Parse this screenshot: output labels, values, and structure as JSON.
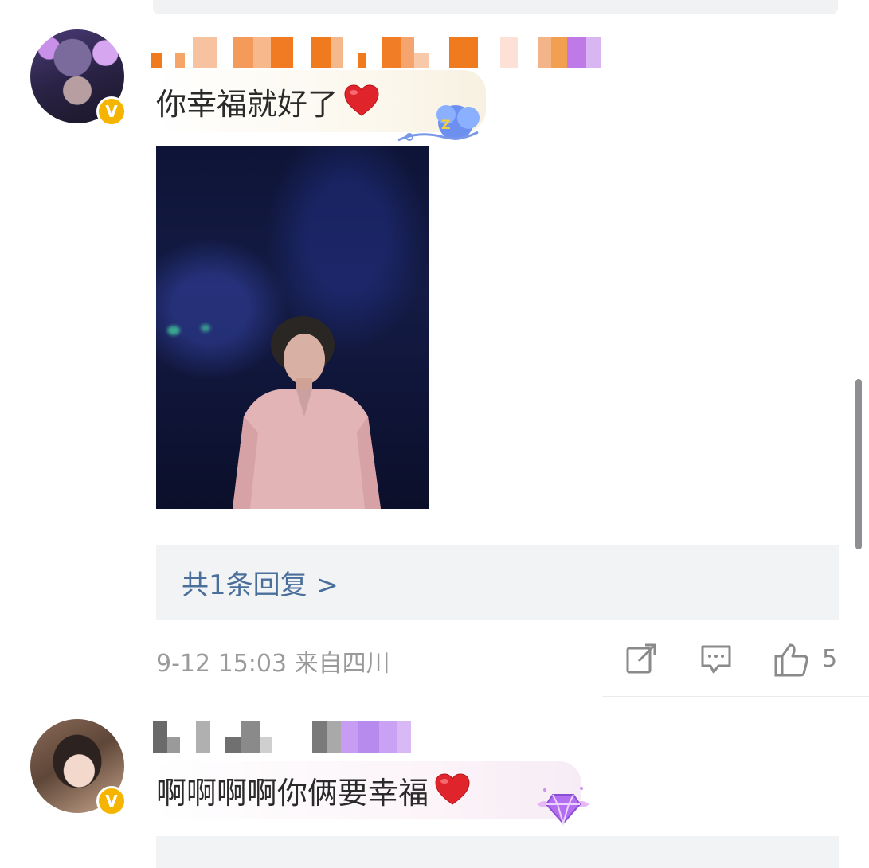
{
  "comments": [
    {
      "text": "你幸福就好了",
      "emoji": "heart",
      "verified_badge": "V",
      "reply_summary": "共1条回复 >",
      "meta": "9-12 15:03 来自四川",
      "actions": {
        "share_icon": "share-icon",
        "comment_icon": "comment-icon",
        "like_icon": "thumbs-up-icon",
        "like_count": "5"
      }
    },
    {
      "text": "啊啊啊啊你俩要幸福",
      "emoji": "heart",
      "verified_badge": "V"
    }
  ],
  "colors": {
    "badge": "#f5b400",
    "reply_link": "#4a6f9a",
    "meta_text": "#9a9a9a",
    "heart": "#e0242b"
  }
}
